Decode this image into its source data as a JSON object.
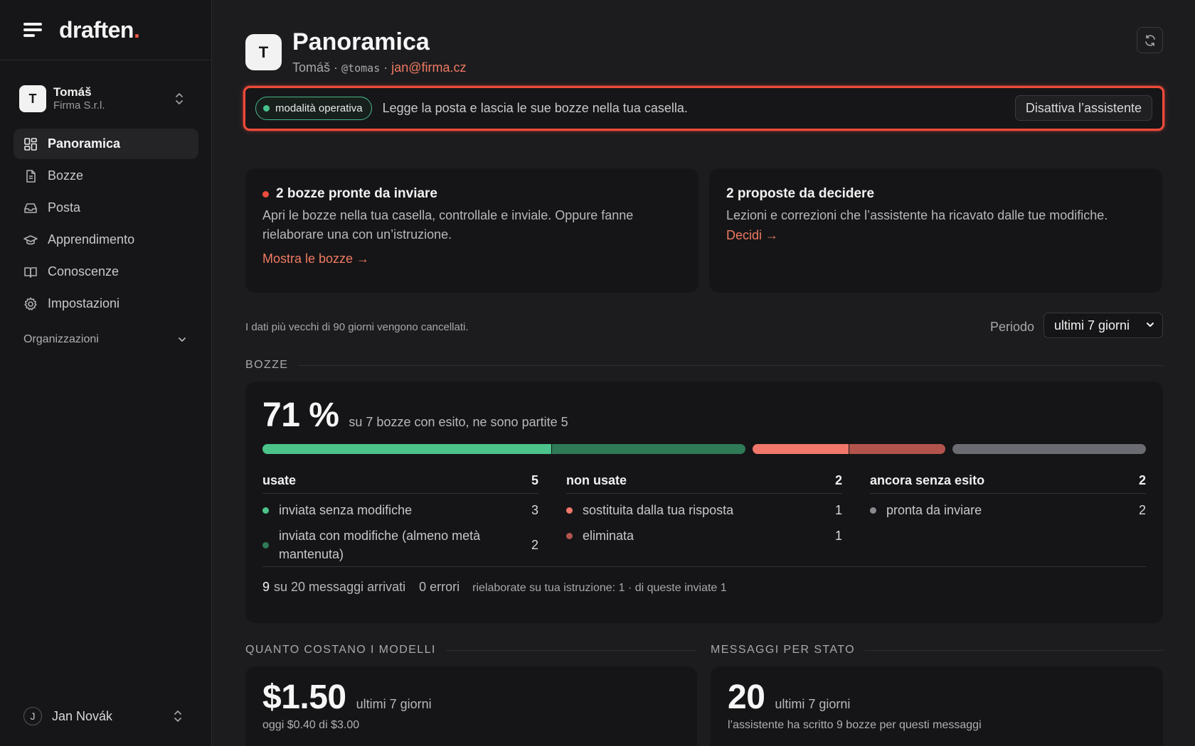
{
  "sidebar": {
    "logo": "draften",
    "logo_dot": ".",
    "account": {
      "initial": "T",
      "name": "Tomáš",
      "org": "Firma S.r.l."
    },
    "nav": [
      {
        "label": "Panoramica",
        "icon": "dashboard-icon",
        "active": true
      },
      {
        "label": "Bozze",
        "icon": "document-icon",
        "active": false
      },
      {
        "label": "Posta",
        "icon": "inbox-icon",
        "active": false
      },
      {
        "label": "Apprendimento",
        "icon": "graduation-cap-icon",
        "active": false
      },
      {
        "label": "Conoscenze",
        "icon": "book-icon",
        "active": false
      },
      {
        "label": "Impostazioni",
        "icon": "gear-icon",
        "active": false
      }
    ],
    "organizations_label": "Organizzazioni",
    "user": {
      "initial": "J",
      "name": "Jan Novák"
    }
  },
  "header": {
    "initial": "T",
    "title": "Panoramica",
    "name": "Tomáš",
    "separator": "·",
    "handle": "@tomas",
    "email": "jan@firma.cz"
  },
  "banner": {
    "mode": "modalità operativa",
    "text": "Legge la posta e lascia le sue bozze nella tua casella.",
    "button": "Disattiva l’assistente"
  },
  "cards": {
    "drafts": {
      "title": "2 bozze pronte da inviare",
      "text": "Apri le bozze nella tua casella, controllale e inviale. Oppure fanne rielaborare una con un’istruzione.",
      "link": "Mostra le bozze →"
    },
    "proposals": {
      "title": "2 proposte da decidere",
      "text": "Lezioni e correzioni che l’assistente ha ricavato dalle tue modifiche.",
      "link": "Decidi →"
    }
  },
  "retention_note": "I dati più vecchi di 90 giorni vengono cancellati.",
  "period": {
    "label": "Periodo",
    "selected": "ultimi 7 giorni"
  },
  "bozze": {
    "section_label": "BOZZE",
    "percent": "71 %",
    "summary": "su 7 bozze con esito, ne sono partite 5",
    "bar_segments": [
      {
        "name": "inviata senza modifiche",
        "value": 3,
        "color": "#4cc38a"
      },
      {
        "name": "inviata con modifiche",
        "value": 2,
        "color": "#2f7a57"
      },
      {
        "name": "sostituita dalla tua risposta",
        "value": 1,
        "color": "#f0776a"
      },
      {
        "name": "eliminata",
        "value": 1,
        "color": "#b3544c"
      },
      {
        "name": "pronta da inviare",
        "value": 2,
        "color": "#6b6b72"
      }
    ],
    "columns": [
      {
        "title": "usate",
        "total": "5",
        "rows": [
          {
            "label": "inviata senza modifiche",
            "value": "3",
            "color": "#4cc38a"
          },
          {
            "label": "inviata con modifiche (almeno metà mantenuta)",
            "value": "2",
            "color": "#2f7a57"
          }
        ]
      },
      {
        "title": "non usate",
        "total": "2",
        "rows": [
          {
            "label": "sostituita dalla tua risposta",
            "value": "1",
            "color": "#f0776a"
          },
          {
            "label": "eliminata",
            "value": "1",
            "color": "#b3544c"
          }
        ]
      },
      {
        "title": "ancora senza esito",
        "total": "2",
        "rows": [
          {
            "label": "pronta da inviare",
            "value": "2",
            "color": "#8a8a90"
          }
        ]
      }
    ],
    "footer": {
      "arrived_count": "9",
      "arrived_text": "su 20 messaggi arrivati",
      "errors": "0 errori",
      "reworked": "rielaborate su tua istruzione: 1 · di queste inviate 1"
    }
  },
  "costs": {
    "section_label": "QUANTO COSTANO I MODELLI",
    "amount": "$1.50",
    "period": "ultimi 7 giorni",
    "today": "oggi $0.40 di $3.00"
  },
  "messages": {
    "section_label": "MESSAGGI PER STATO",
    "count": "20",
    "period": "ultimi 7 giorni",
    "note": "l’assistente ha scritto 9 bozze per questi messaggi"
  }
}
